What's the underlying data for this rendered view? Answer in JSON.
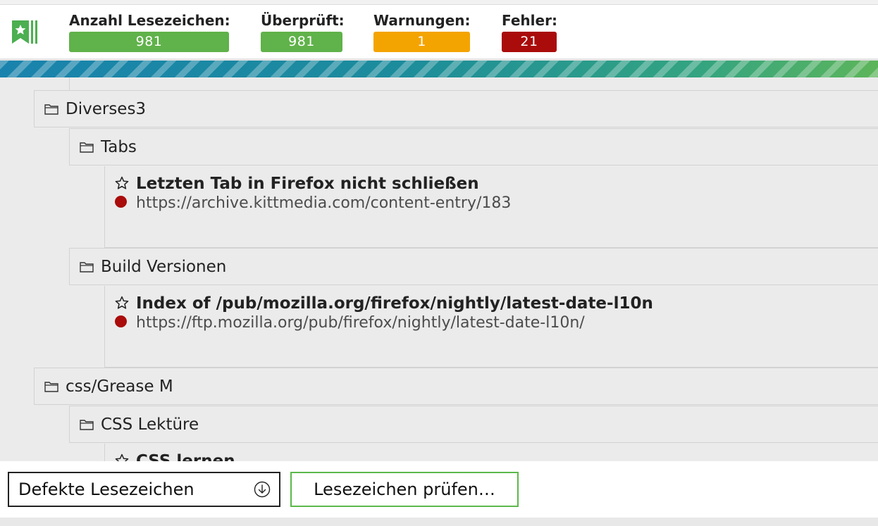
{
  "header": {
    "logo_icon": "bookmark-check-icon",
    "stats": {
      "total_label": "Anzahl Lesezeichen:",
      "total_value": "981",
      "checked_label": "Überprüft:",
      "checked_value": "981",
      "warnings_label": "Warnungen:",
      "warnings_value": "1",
      "errors_label": "Fehler:",
      "errors_value": "21"
    },
    "colors": {
      "ok": "#60b24a",
      "warning": "#f4a400",
      "error": "#a90c0a"
    },
    "progress": 1.0
  },
  "tree": {
    "folders": [
      {
        "name": "Diverses3"
      },
      {
        "name": "Tabs"
      },
      {
        "name": "Build Versionen"
      },
      {
        "name": "css/Grease M"
      },
      {
        "name": "CSS Lektüre"
      }
    ],
    "bookmarks": [
      {
        "title": "Letzten Tab in Firefox nicht schließen",
        "url": "https://archive.kittmedia.com/content-entry/183",
        "status": "error"
      },
      {
        "title": "Index of /pub/mozilla.org/firefox/nightly/latest-date-l10n",
        "url": "https://ftp.mozilla.org/pub/firefox/nightly/latest-date-l10n/",
        "status": "error"
      },
      {
        "title": "CSS lernen",
        "url": "",
        "status": "unknown"
      }
    ]
  },
  "footer": {
    "filter_selected": "Defekte Lesezeichen",
    "check_button_label": "Lesezeichen prüfen…"
  }
}
